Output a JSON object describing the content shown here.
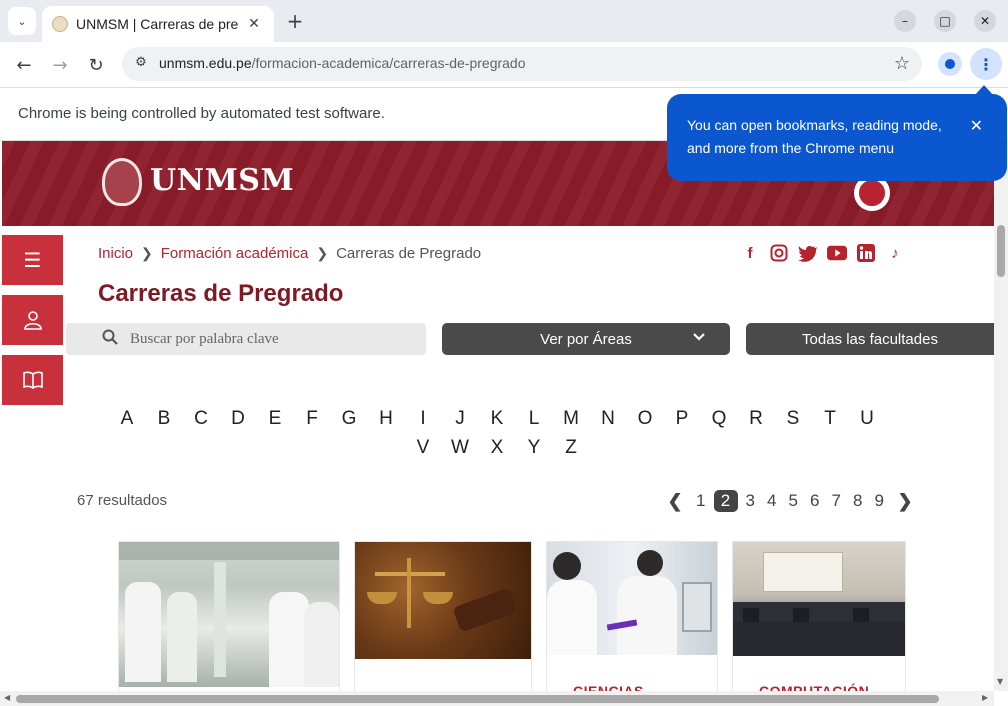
{
  "browser": {
    "tab_title": "UNMSM | Carreras de pre",
    "url_host": "unmsm.edu.pe",
    "url_path": "/formacion-academica/carreras-de-pregrado",
    "infobar_text": "Chrome is being controlled by automated test software.",
    "bubble_text": "You can open bookmarks, reading mode, and more from the Chrome menu"
  },
  "site": {
    "logo_text": "UNMSM",
    "breadcrumb": {
      "home": "Inicio",
      "section": "Formación académica",
      "current": "Carreras de Pregrado"
    },
    "social": [
      "f",
      "ig",
      "tw",
      "yt",
      "in",
      "tt"
    ],
    "page_title": "Carreras de Pregrado",
    "search_placeholder": "Buscar por palabra clave",
    "areas_label": "Ver por Áreas",
    "faculties_label": "Todas las facultades",
    "alphabet_row1": [
      "A",
      "B",
      "C",
      "D",
      "E",
      "F",
      "G",
      "H",
      "I",
      "J",
      "K",
      "L",
      "M",
      "N",
      "O",
      "P",
      "Q",
      "R",
      "S",
      "T",
      "U"
    ],
    "alphabet_row2": [
      "V",
      "W",
      "X",
      "Y",
      "Z"
    ],
    "results_text": "67 resultados",
    "pagination": {
      "pages": [
        "1",
        "2",
        "3",
        "4",
        "5",
        "6",
        "7",
        "8",
        "9"
      ],
      "current": "2"
    },
    "cards": [
      {
        "title": ""
      },
      {
        "title": ""
      },
      {
        "title": "CIENCIAS"
      },
      {
        "title": "COMPUTACIÓN"
      }
    ]
  }
}
